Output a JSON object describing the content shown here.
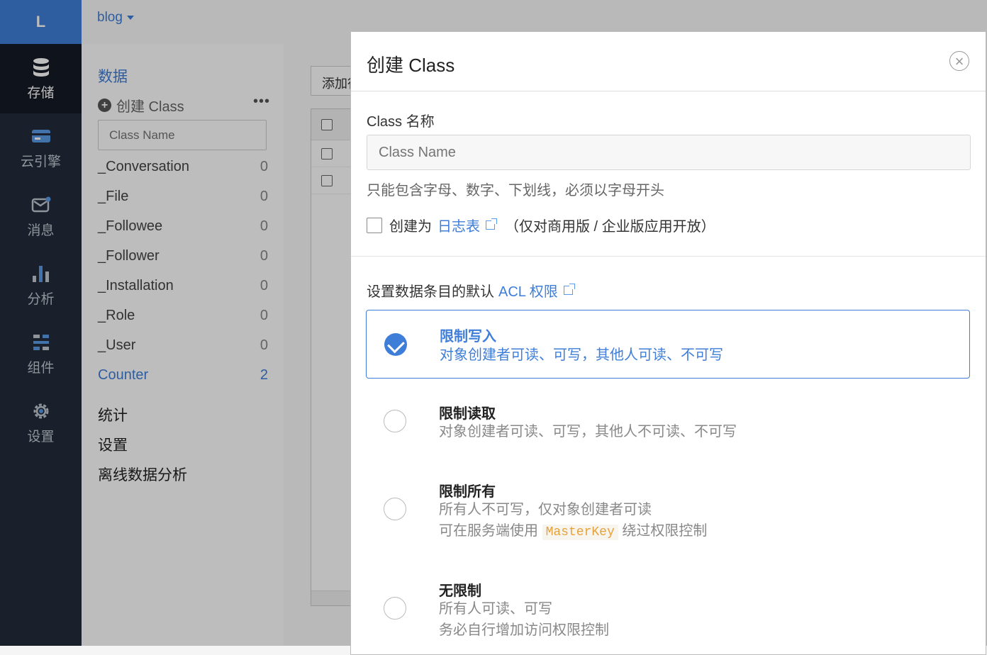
{
  "nav": {
    "logo": "L",
    "items": [
      {
        "label": "存储",
        "icon": "database-icon",
        "active": true
      },
      {
        "label": "云引擎",
        "icon": "cloud-engine-icon",
        "active": false
      },
      {
        "label": "消息",
        "icon": "message-icon",
        "active": false
      },
      {
        "label": "分析",
        "icon": "analytics-icon",
        "active": false
      },
      {
        "label": "组件",
        "icon": "components-icon",
        "active": false
      },
      {
        "label": "设置",
        "icon": "gear-icon",
        "active": false
      }
    ]
  },
  "topbar": {
    "app_name": "blog"
  },
  "sidebar": {
    "heading": "数据",
    "create_label": "创建 Class",
    "more": "•••",
    "search_placeholder": "Class Name",
    "classes": [
      {
        "name": "_Conversation",
        "count": "0"
      },
      {
        "name": "_File",
        "count": "0"
      },
      {
        "name": "_Followee",
        "count": "0"
      },
      {
        "name": "_Follower",
        "count": "0"
      },
      {
        "name": "_Installation",
        "count": "0"
      },
      {
        "name": "_Role",
        "count": "0"
      },
      {
        "name": "_User",
        "count": "0"
      },
      {
        "name": "Counter",
        "count": "2",
        "active": true
      }
    ],
    "links": [
      "统计",
      "设置",
      "离线数据分析"
    ]
  },
  "main": {
    "add_button": "添加行"
  },
  "modal": {
    "title": "创建 Class",
    "close": "×",
    "name_label": "Class 名称",
    "name_placeholder": "Class Name",
    "name_help": "只能包含字母、数字、下划线，必须以字母开头",
    "log_prefix": "创建为",
    "log_link": "日志表",
    "log_suffix": "（仅对商用版 / 企业版应用开放）",
    "acl_prefix": "设置数据条目的默认",
    "acl_link": "ACL 权限",
    "options": [
      {
        "title": "限制写入",
        "desc1": "对象创建者可读、可写，其他人可读、不可写",
        "selected": true
      },
      {
        "title": "限制读取",
        "desc1": "对象创建者可读、可写，其他人不可读、不可写",
        "selected": false
      },
      {
        "title": "限制所有",
        "desc1": "所有人不可写，仅对象创建者可读",
        "desc2_prefix": "可在服务端使用",
        "desc2_code": "MasterKey",
        "desc2_suffix": "绕过权限控制",
        "selected": false
      },
      {
        "title": "无限制",
        "desc1": "所有人可读、可写",
        "desc2": "务必自行增加访问权限控制",
        "selected": false
      }
    ]
  },
  "colors": {
    "accent": "#3f7ed8",
    "nav_bg": "#222a3a",
    "logo_bg": "#3f7ed8"
  }
}
